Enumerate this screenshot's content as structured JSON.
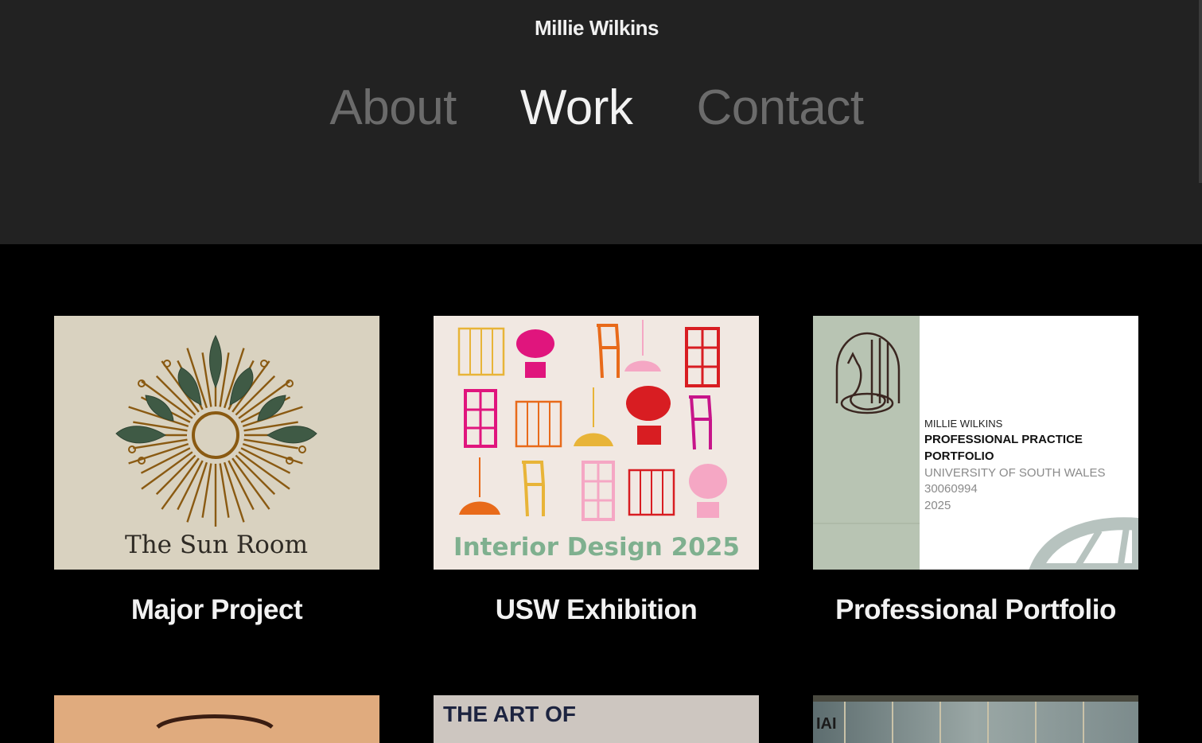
{
  "site": {
    "name": "Millie Wilkins"
  },
  "nav": {
    "items": [
      {
        "label": "About",
        "active": false
      },
      {
        "label": "Work",
        "active": true
      },
      {
        "label": "Contact",
        "active": false
      }
    ],
    "active_color": "#f2f2f2",
    "inactive_color": "#6b6b6b"
  },
  "projects": [
    {
      "title": "Major Project",
      "thumb": {
        "caption": "The Sun Room",
        "bg": "#d9d2c0"
      }
    },
    {
      "title": "USW Exhibition",
      "thumb": {
        "caption": "Interior Design 2025",
        "bg": "#f1e8e2"
      }
    },
    {
      "title": "Professional Portfolio",
      "thumb": {
        "line1": "MILLIE WILKINS",
        "line2": "PROFESSIONAL PRACTICE",
        "line3": "PORTFOLIO",
        "line4": "UNIVERSITY OF SOUTH WALES",
        "line5": "30060994",
        "line6": "2025",
        "side_color": "#b8c4b3"
      }
    },
    {
      "title": "",
      "thumb": {
        "bg": "#e0ab7e"
      }
    },
    {
      "title": "",
      "thumb": {
        "caption": "THE ART OF",
        "bg": "#cdc6c0"
      }
    },
    {
      "title": "",
      "thumb": {
        "caption": "IAI",
        "bg": "#7a8b8f"
      }
    }
  ]
}
